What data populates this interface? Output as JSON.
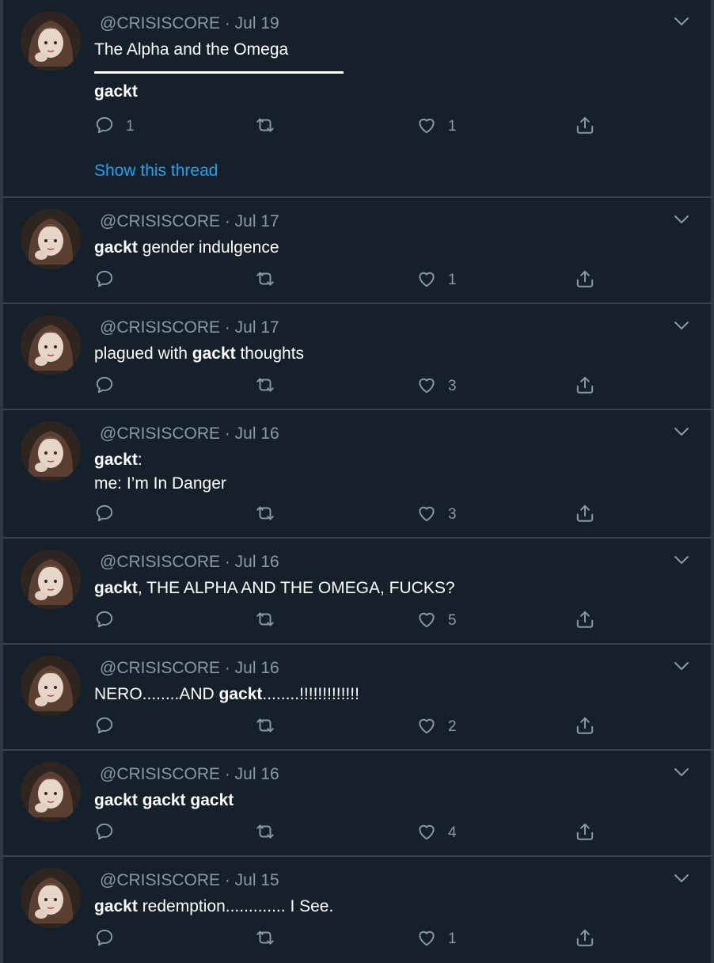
{
  "tweets": [
    {
      "handle": "@CRISISCORE",
      "date": "· Jul 19",
      "text": "The Alpha and the Omega",
      "quoted": "gackt",
      "reply_count": "1",
      "retweet_count": "",
      "like_count": "1",
      "thread_link": "Show this thread"
    },
    {
      "handle": "@CRISISCORE",
      "date": "· Jul 17",
      "bold": "gackt",
      "text": " gender indulgence",
      "reply_count": "",
      "retweet_count": "",
      "like_count": "1"
    },
    {
      "handle": "@CRISISCORE",
      "date": "· Jul 17",
      "pre": "plagued with ",
      "bold": "gackt",
      "text": " thoughts",
      "reply_count": "",
      "retweet_count": "",
      "like_count": "3"
    },
    {
      "handle": "@CRISISCORE",
      "date": "· Jul 16",
      "bold": "gackt",
      "text": ":",
      "line2": "me: I’m In Danger",
      "reply_count": "",
      "retweet_count": "",
      "like_count": "3"
    },
    {
      "handle": "@CRISISCORE",
      "date": "· Jul 16",
      "bold": "gackt",
      "text": ", THE ALPHA AND THE OMEGA, FUCKS?",
      "reply_count": "",
      "retweet_count": "",
      "like_count": "5"
    },
    {
      "handle": "@CRISISCORE",
      "date": "· Jul 16",
      "pre": "NERO........AND ",
      "bold": "gackt",
      "text": "........!!!!!!!!!!!!!",
      "reply_count": "",
      "retweet_count": "",
      "like_count": "2"
    },
    {
      "handle": "@CRISISCORE",
      "date": "· Jul 16",
      "bold": "gackt gackt gackt",
      "text": "",
      "reply_count": "",
      "retweet_count": "",
      "like_count": "4"
    },
    {
      "handle": "@CRISISCORE",
      "date": "· Jul 15",
      "bold": "gackt",
      "text": " redemption............. I See.",
      "reply_count": "",
      "retweet_count": "",
      "like_count": "1"
    }
  ],
  "icons": {
    "reply": "reply-icon",
    "retweet": "retweet-icon",
    "like": "heart-icon",
    "share": "share-icon",
    "caret": "chevron-down-icon"
  },
  "colors": {
    "background": "#15202b",
    "muted": "#8899a6",
    "link": "#1da1f2",
    "border": "#38444d"
  }
}
